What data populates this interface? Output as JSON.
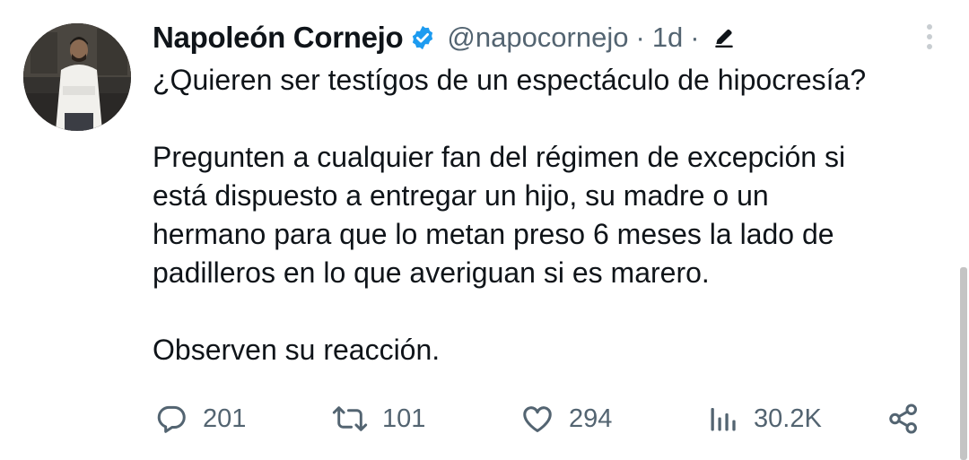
{
  "tweet": {
    "author": {
      "display_name": "Napoleón Cornejo",
      "handle": "@napocornejo",
      "separator": "·",
      "time": "1d",
      "verified": true,
      "verified_color": "#1d9bf0"
    },
    "text": {
      "line1": "¿Quieren ser testígos de un espectáculo de hipocresía?",
      "line2": "Pregunten a cualquier fan del régimen de excepción si",
      "line3": "está dispuesto a entregar un hijo, su madre o un",
      "line4": "hermano para que lo metan preso 6 meses la lado de",
      "line5": "padilleros en lo que averiguan si es marero.",
      "line6": "Observen su reacción."
    },
    "actions": {
      "replies": "201",
      "retweets": "101",
      "likes": "294",
      "views": "30.2K"
    },
    "icons": [
      "verified-badge-icon",
      "edit-icon",
      "more-icon",
      "reply-icon",
      "retweet-icon",
      "like-icon",
      "views-icon",
      "share-icon"
    ]
  },
  "colors": {
    "text": "#0f1419",
    "secondary": "#536471",
    "accent": "#1d9bf0"
  }
}
